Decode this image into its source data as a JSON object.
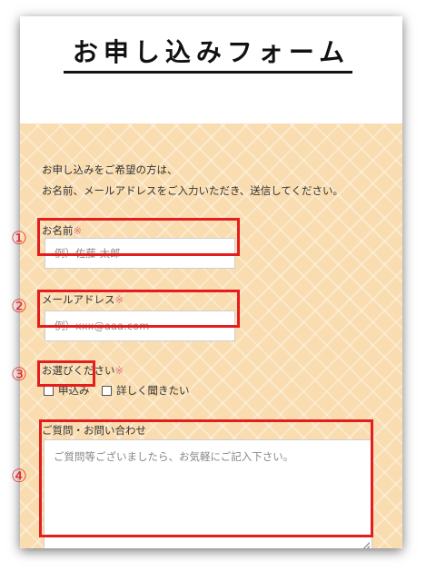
{
  "form": {
    "title": "お申し込みフォーム",
    "intro_line1": "お申し込みをご希望の方は、",
    "intro_line2": "お名前、メールアドレスをご入力いただき、送信してください。",
    "name_label": "お名前",
    "email_label": "メールアドレス",
    "choice_label": "お選びください",
    "required_mark": "※",
    "name_placeholder": "例）佐藤 太郎",
    "email_placeholder": "例）xxx@aaa.com",
    "option1": "申込み",
    "option2": "詳しく聞きたい",
    "question_label": "ご質問・お問い合わせ",
    "question_placeholder": "ご質問等ございましたら、お気軽にご記入下さい。"
  },
  "annotations": {
    "n1": "①",
    "n2": "②",
    "n3": "③",
    "n4": "④"
  },
  "colors": {
    "highlight": "#e41e1e",
    "background_pattern": "#f9ddb0"
  }
}
